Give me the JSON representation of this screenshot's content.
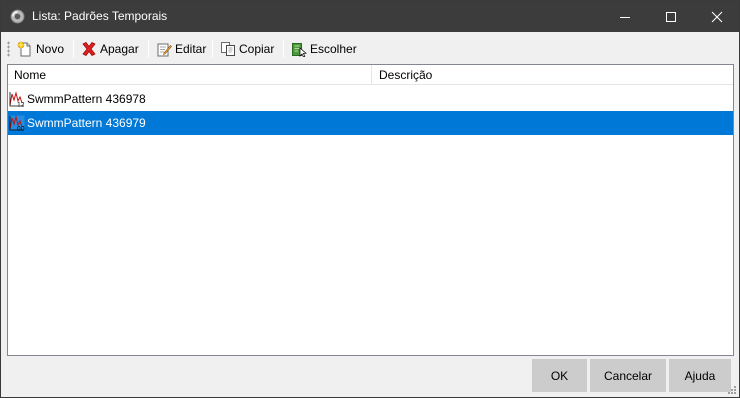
{
  "window": {
    "title": "Lista: Padrões Temporais",
    "controls": {
      "minimize_icon": "minimize-icon",
      "maximize_icon": "maximize-icon",
      "close_icon": "close-icon"
    }
  },
  "toolbar": {
    "buttons": [
      {
        "label": "Novo",
        "icon": "new-document-icon"
      },
      {
        "label": "Apagar",
        "icon": "delete-x-icon"
      },
      {
        "label": "Editar",
        "icon": "edit-pencil-icon"
      },
      {
        "label": "Copiar",
        "icon": "copy-icon"
      },
      {
        "label": "Escolher",
        "icon": "choose-icon"
      }
    ]
  },
  "list": {
    "columns": [
      "Nome",
      "Descrição"
    ],
    "rows": [
      {
        "name": "SwmmPattern 436978",
        "description": "",
        "selected": false,
        "icon": "pattern-icon"
      },
      {
        "name": "SwmmPattern 436979",
        "description": "",
        "selected": true,
        "icon": "pattern-icon"
      }
    ]
  },
  "footer": {
    "ok_label": "OK",
    "cancel_label": "Cancelar",
    "help_label": "Ajuda"
  },
  "colors": {
    "titlebar": "#3c3c3c",
    "selection": "#0078d7",
    "footer_button": "#cccccc",
    "delete_red": "#e02020"
  }
}
